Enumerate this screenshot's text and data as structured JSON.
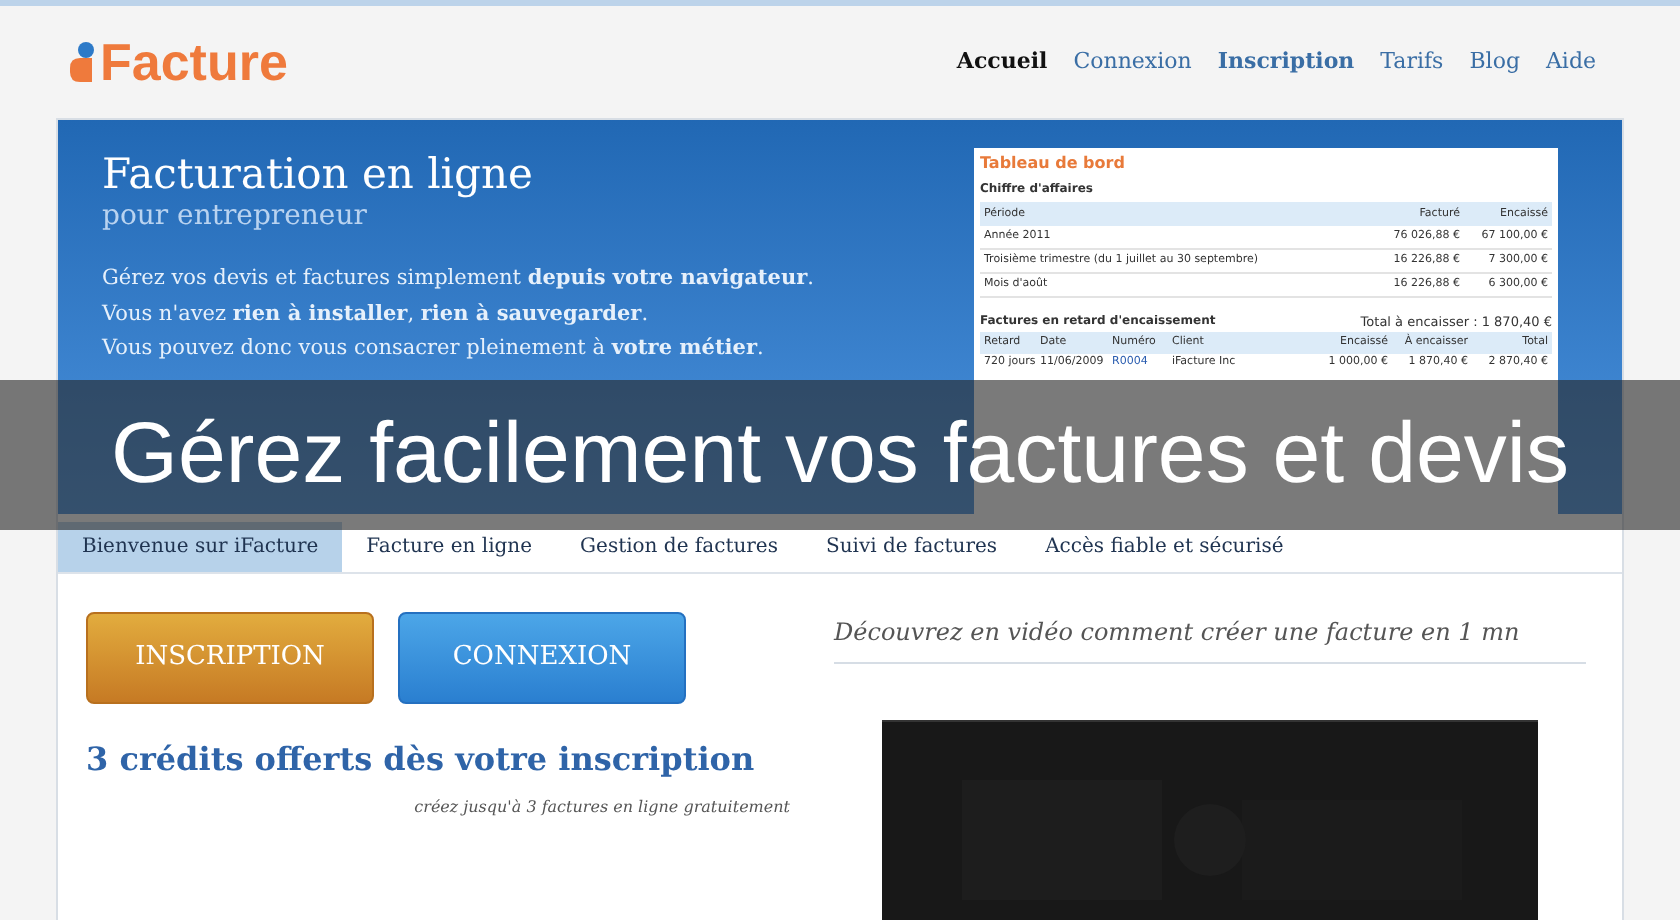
{
  "logo": {
    "text": "Facture"
  },
  "nav": [
    {
      "label": "Accueil",
      "selected": true,
      "bold": true
    },
    {
      "label": "Connexion",
      "selected": false,
      "bold": false
    },
    {
      "label": "Inscription",
      "selected": false,
      "bold": true
    },
    {
      "label": "Tarifs",
      "selected": false,
      "bold": false
    },
    {
      "label": "Blog",
      "selected": false,
      "bold": false
    },
    {
      "label": "Aide",
      "selected": false,
      "bold": false
    }
  ],
  "hero": {
    "title": "Facturation en ligne",
    "subtitle": "pour entrepreneur",
    "lines": [
      "Gérez vos devis et factures simplement **depuis votre navigateur**.",
      "Vous n'avez **rien à installer**, **rien à sauvegarder**.",
      "Vous pouvez donc vous consacrer pleinement à **votre métier**."
    ]
  },
  "dashboard": {
    "title": "Tableau de bord",
    "revenue": {
      "title": "Chiffre d'affaires",
      "columns": [
        "Période",
        "Facturé",
        "Encaissé"
      ],
      "rows": [
        [
          "Année 2011",
          "76 026,88 €",
          "67 100,00 €"
        ],
        [
          "Troisième trimestre (du 1 juillet au 30 septembre)",
          "16 226,88 €",
          "7 300,00 €"
        ],
        [
          "Mois d'août",
          "16 226,88 €",
          "6 300,00 €"
        ]
      ]
    },
    "late": {
      "title": "Factures en retard d'encaissement",
      "total": "Total à encaisser : 1 870,40 €",
      "columns": [
        "Retard",
        "Date",
        "Numéro",
        "Client",
        "Encaissé",
        "À encaisser",
        "Total"
      ],
      "rows": [
        [
          "720 jours",
          "11/06/2009",
          "R0004",
          "iFacture Inc",
          "1 000,00 €",
          "1 870,40 €",
          "2 870,40 €"
        ]
      ]
    }
  },
  "overlay_caption": "Gérez facilement vos factures et devis",
  "tabs": [
    {
      "label": "Bienvenue sur iFacture",
      "selected": true
    },
    {
      "label": "Facture en ligne",
      "selected": false
    },
    {
      "label": "Gestion de factures",
      "selected": false
    },
    {
      "label": "Suivi de factures",
      "selected": false
    },
    {
      "label": "Accès fiable et sécurisé",
      "selected": false
    }
  ],
  "buttons": [
    {
      "label": "INSCRIPTION",
      "kind": "orange"
    },
    {
      "label": "CONNEXION",
      "kind": "blue"
    }
  ],
  "credits": {
    "title": "3 crédits offerts dès votre inscription",
    "note": "créez jusqu'à 3 factures en ligne gratuitement"
  },
  "video": {
    "heading": "Découvrez en vidéo comment créer une facture en 1 mn"
  }
}
